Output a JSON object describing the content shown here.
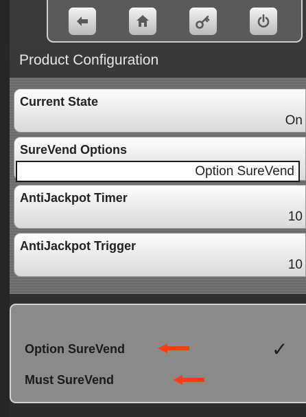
{
  "toolbar": {
    "buttons": [
      {
        "icon": "back-arrow-icon"
      },
      {
        "icon": "home-icon"
      },
      {
        "icon": "key-icon"
      },
      {
        "icon": "power-icon"
      }
    ]
  },
  "page": {
    "title": "Product Configuration"
  },
  "settings": {
    "current_state": {
      "label": "Current State",
      "value": "On"
    },
    "surevend_options": {
      "label": "SureVend Options",
      "value": "Option SureVend"
    },
    "antijackpot_timer": {
      "label": "AntiJackpot Timer",
      "value": "10"
    },
    "antijackpot_trigger": {
      "label": "AntiJackpot Trigger",
      "value": "10"
    }
  },
  "dropdown": {
    "options": [
      {
        "label": "Option SureVend",
        "selected": true,
        "check": "✓"
      },
      {
        "label": "Must SureVend",
        "selected": false
      }
    ],
    "annotation_color": "#ff3a10"
  }
}
